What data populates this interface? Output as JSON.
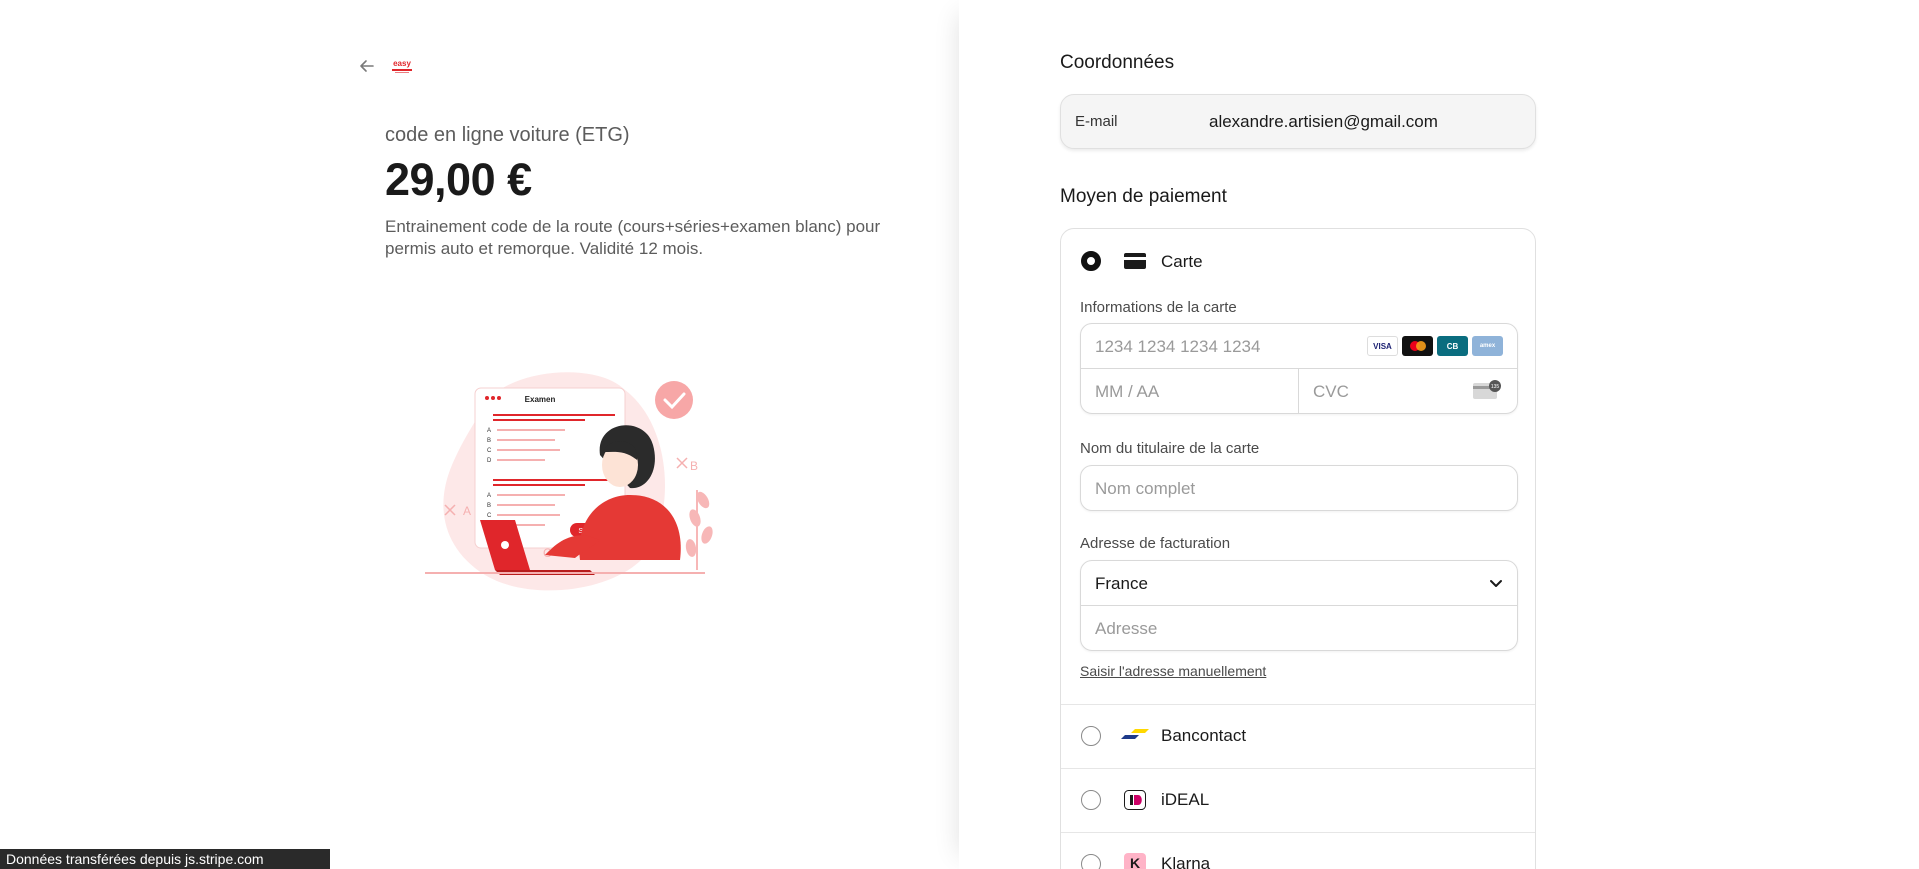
{
  "left": {
    "product_name": "code en ligne voiture (ETG)",
    "price": "29,00 €",
    "description": "Entrainement code de la route (cours+séries+examen blanc) pour permis auto et remorque. Validité 12 mois.",
    "illustration": {
      "sheet_title": "Examen",
      "options": [
        "A",
        "B",
        "C",
        "D"
      ],
      "button": "Suivant"
    },
    "status_bar": "Données transférées depuis js.stripe.com"
  },
  "contact": {
    "title": "Coordonnées",
    "email_label": "E-mail",
    "email_value": "alexandre.artisien@gmail.com"
  },
  "payment": {
    "title": "Moyen de paiement",
    "card": {
      "label": "Carte",
      "info_label": "Informations de la carte",
      "number_placeholder": "1234 1234 1234 1234",
      "expiry_placeholder": "MM / AA",
      "cvc_placeholder": "CVC",
      "brands": [
        "VISA",
        "mastercard",
        "CB",
        "amex"
      ],
      "holder_label": "Nom du titulaire de la carte",
      "holder_placeholder": "Nom complet",
      "billing_label": "Adresse de facturation",
      "country_value": "France",
      "address_placeholder": "Adresse",
      "manual_link": "Saisir l'adresse manuellement"
    },
    "methods": [
      {
        "label": "Bancontact",
        "icon": "bancontact-icon"
      },
      {
        "label": "iDEAL",
        "icon": "ideal-icon"
      },
      {
        "label": "Klarna",
        "icon": "klarna-icon"
      }
    ]
  },
  "colors": {
    "brand_red": "#e0262b",
    "illustration_pink": "#fbd9d9",
    "text_muted": "#5c5c5c"
  }
}
